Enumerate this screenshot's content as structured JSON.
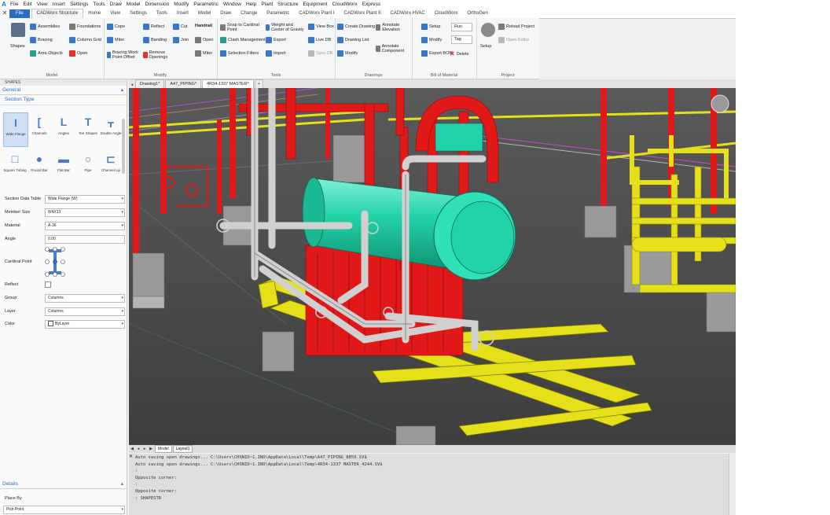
{
  "menubar": {
    "logo": "A",
    "items": [
      "File",
      "Edit",
      "View",
      "Insert",
      "Settings",
      "Tools",
      "Draw",
      "Model",
      "Dimension",
      "Modify",
      "Parametric",
      "Window",
      "Help",
      "Plant",
      "Structure",
      "Equipment",
      "CloudWorx",
      "Express"
    ]
  },
  "ribbon_tabs": [
    "File",
    "CADWorx Structure",
    "Home",
    "View",
    "Settings",
    "Tools",
    "Insert",
    "Model",
    "Draw",
    "Change",
    "Parametric",
    "CADWorx Plant I",
    "CADWorx Plant II",
    "CADWorx HVAC",
    "CloudWorx",
    "OrthoGen"
  ],
  "active_ribbon_tab": "CADWorx Structure",
  "ribbon": {
    "model": {
      "label": "Model",
      "shapes": "Shapes",
      "assemblies": "Assemblies",
      "foundations": "Foundations",
      "bracing": "Bracing",
      "column_grid": "Column Grid",
      "area_objects": "Area Objects",
      "open": "Open"
    },
    "modify": {
      "label": "Modify",
      "cope": "Cope",
      "reflect": "Reflect",
      "cut": "Cut",
      "miter": "Miter",
      "banding": "Banding",
      "join": "Join",
      "bracing_work_point_offset": "Bracing Work Point Offset",
      "remove_openings": "Remove Openings",
      "handrail": "Handrail",
      "hr_open": "Open",
      "hr_miter": "Miter"
    },
    "tools": {
      "label": "Tools",
      "snap": "Snap to Cardinal Point",
      "weight": "Weight and Center of Gravity",
      "view_box": "View Box",
      "clash": "Clash Management",
      "export": "Export",
      "live_db": "Live DB",
      "selection_filters": "Selection Filters",
      "import": "Import",
      "sync_db": "Sync DB"
    },
    "drawings": {
      "label": "Drawings",
      "create_drawing": "Create Drawing",
      "annotate_elevation": "Annotate Elevation",
      "drawing_list": "Drawing List",
      "modify": "Modify",
      "annotate_component": "Annotate Component"
    },
    "bom": {
      "label": "Bill of Material",
      "setup": "Setup",
      "modify": "Modify",
      "export_bom": "Export BOM",
      "run": "Run",
      "tag": "Tag",
      "delete": "Delete"
    },
    "project": {
      "label": "Project",
      "setup": "Setup",
      "reload_project": "Reload Project",
      "open_editor": "Open Editor"
    }
  },
  "left_panel": {
    "title": "SHAPES",
    "general": "General",
    "section_type": "Section Type",
    "shapes": [
      "Wide Flange",
      "Channels",
      "Angles",
      "Tee Shapes",
      "Double Angle",
      "Square Tubing",
      "Round Bar",
      "Flat Bar",
      "Pipe",
      "Channel Lip"
    ],
    "properties": [
      {
        "label": "Section Data Table",
        "value": "Wide Flange (W)"
      },
      {
        "label": "Member Size",
        "value": "W4X13"
      },
      {
        "label": "Material",
        "value": "A-36"
      },
      {
        "label": "Angle",
        "value": "0.00"
      }
    ],
    "cardinal_point": "Cardinal Point",
    "reflect": "Reflect",
    "group": {
      "label": "Group",
      "value": "Columns"
    },
    "layer": {
      "label": "Layer",
      "value": "Columns"
    },
    "color": {
      "label": "Color",
      "value": "ByLayer"
    },
    "details": "Details",
    "place_by": "Place By",
    "place_by_value": "Pick Point"
  },
  "doc_tabs": [
    "Drawing1*",
    "A47_PIPING*",
    "4R34-1337 MASTER*"
  ],
  "active_doc_tab": "4R34-1337 MASTER*",
  "layout_tabs": [
    "Model",
    "Layout1"
  ],
  "command_lines": [
    "Auto saving open drawings... C:\\Users\\CHSNID~1.INO\\AppData\\Local\\Temp\\A47_PIPING_8859.SV$",
    "Auto saving open drawings... C:\\Users\\CHSNID~1.INO\\AppData\\Local\\Temp\\4R34-1337 MASTER_4244.SV$",
    ":",
    "Opposite corner:",
    ":",
    "Opposite corner:",
    ": SHAPESTR"
  ],
  "colors": {
    "accent": "#2b6cc4",
    "pipe_red": "#e01818",
    "equipment_teal": "#22d3a9",
    "steel_yellow": "#e6e01a",
    "pipe_white": "#d9d9d9",
    "concrete": "#9a9a9a",
    "ground": "#4a4a4a"
  }
}
